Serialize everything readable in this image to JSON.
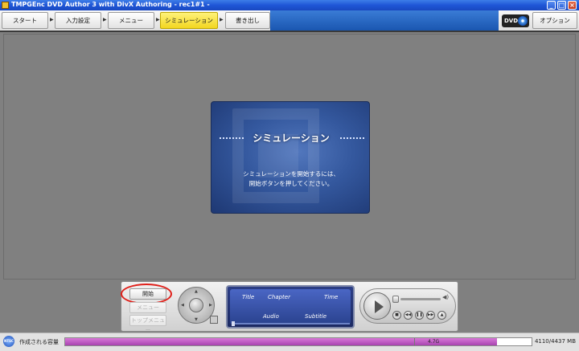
{
  "window": {
    "title": "TMPGEnc DVD Author 3 with DivX Authoring - rec1#1 -"
  },
  "nav": {
    "tabs": [
      {
        "label": "スタート",
        "active": false
      },
      {
        "label": "入力設定",
        "active": false
      },
      {
        "label": "メニュー",
        "active": false
      },
      {
        "label": "シミュレーション",
        "active": true
      },
      {
        "label": "書き出し",
        "active": false
      }
    ],
    "dvd_badge": "DVD",
    "options_label": "オプション"
  },
  "card": {
    "title": "シミュレーション",
    "message_line1": "シミュレーションを開始するには、",
    "message_line2": "開始ボタンを押してください。"
  },
  "controls": {
    "start_label": "開始",
    "disabled_label_1": "メニュー",
    "disabled_label_2": "トップメニュー",
    "info": {
      "title_label": "Title",
      "chapter_label": "Chapter",
      "time_label": "Time",
      "audio_label": "Audio",
      "subtitle_label": "Subtitle"
    }
  },
  "status": {
    "format_icon": "NTSC",
    "capacity_label": "作成される容量",
    "disc_mark": "4.7G",
    "capacity_value": "4110/4437 MB",
    "used_fraction": 0.926
  },
  "colors": {
    "active_tab": "#f2d620",
    "capacity_fill": "#b050b8",
    "highlight_ring": "#e0201a",
    "card_bg": "#34589e"
  }
}
